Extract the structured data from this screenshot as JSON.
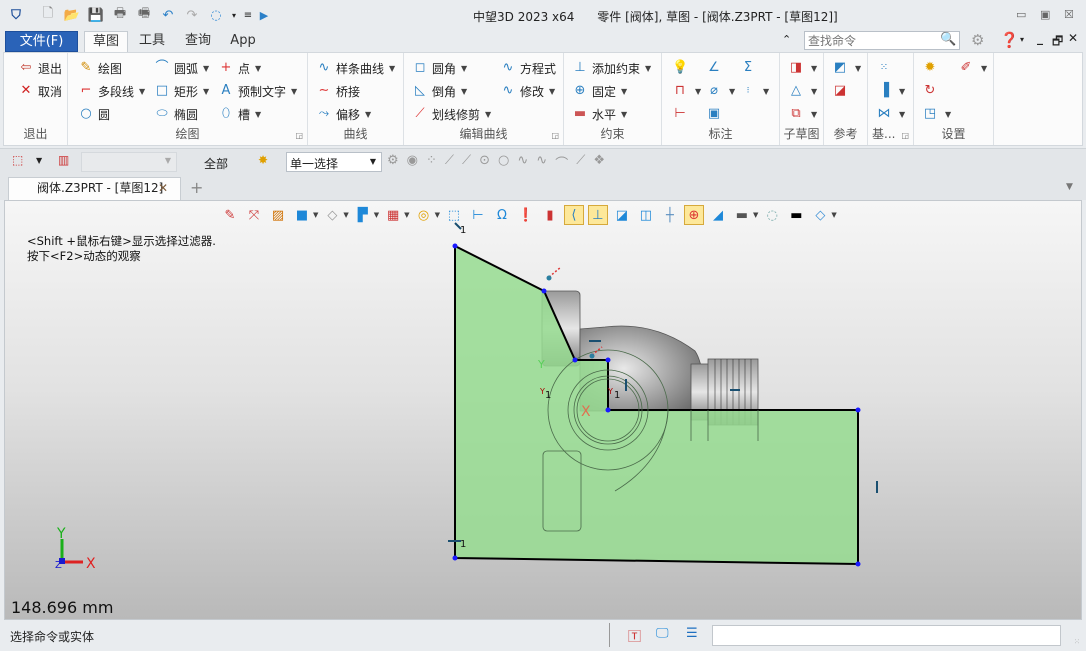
{
  "titlebar": {
    "title": "中望3D 2023 x64      零件 [阀体], 草图 - [阀体.Z3PRT - [草图12]]",
    "quick_access": [
      "app-logo-icon",
      "new-icon",
      "open-icon",
      "save-icon",
      "print-icon",
      "print-preview-icon",
      "undo-icon",
      "redo-icon",
      "view-rotate-icon",
      "customize-icon",
      "run-icon"
    ],
    "window_controls": [
      "minimize",
      "restore",
      "close"
    ]
  },
  "menu": {
    "file": "文件(F)",
    "tabs": [
      "草图",
      "工具",
      "查询",
      "App"
    ],
    "active_tab": "草图",
    "search_placeholder": "查找命令"
  },
  "ribbon": {
    "groups": [
      {
        "name": "退出",
        "items": [
          "退出",
          "取消"
        ]
      },
      {
        "name": "绘图",
        "items": [
          "绘图",
          "多段线",
          "圆",
          "圆弧",
          "矩形",
          "椭圆",
          "点",
          "预制文字",
          "槽"
        ]
      },
      {
        "name": "曲线",
        "items": [
          "样条曲线",
          "桥接",
          "偏移"
        ]
      },
      {
        "name": "编辑曲线",
        "items": [
          "圆角",
          "倒角",
          "划线修剪",
          "方程式",
          "修改"
        ]
      },
      {
        "name": "约束",
        "items": [
          "添加约束",
          "固定",
          "水平"
        ]
      },
      {
        "name": "标注",
        "items": []
      },
      {
        "name": "子草图",
        "items": []
      },
      {
        "name": "参考",
        "items": []
      },
      {
        "name": "基...",
        "items": []
      },
      {
        "name": "设置",
        "items": []
      }
    ]
  },
  "selection_bar": {
    "filter_value": "",
    "scope": "全部",
    "mode": "单一选择"
  },
  "document": {
    "tab_label": "阀体.Z3PRT - [草图12]",
    "add_tab": "+"
  },
  "viewport": {
    "hint_line1": "<Shift +鼠标右键>显示选择过滤器.",
    "hint_line2": "按下<F2>动态的观察",
    "scale": "148.696 mm",
    "axis_x": "X",
    "axis_y": "Y",
    "axis_z": "Z",
    "constraint_label": "1",
    "sketch_fill": "#9ddc98",
    "point_color": "#1a1aff"
  },
  "status": {
    "text": "选择命令或实体",
    "command_value": ""
  }
}
